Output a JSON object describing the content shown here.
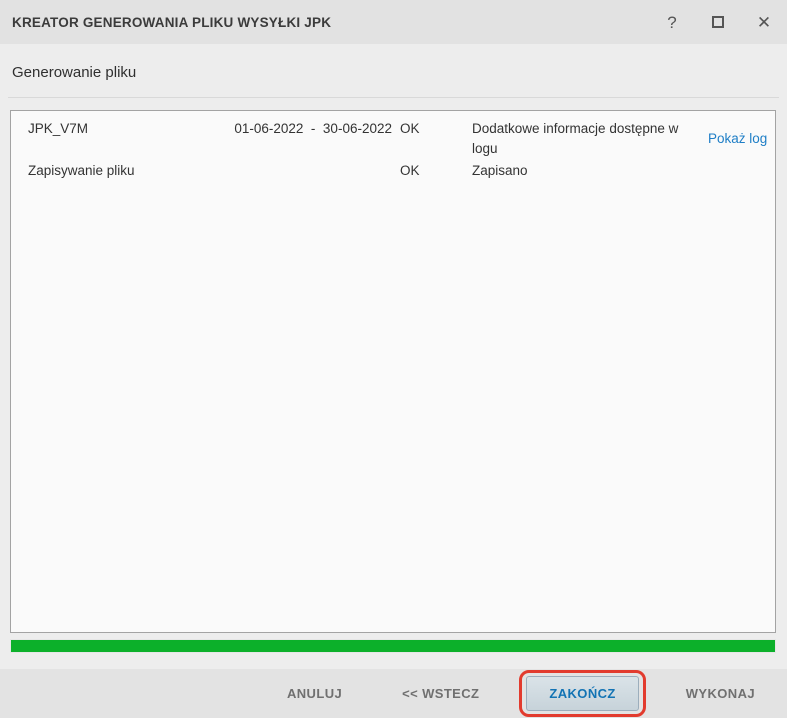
{
  "window": {
    "title": "KREATOR GENEROWANIA PLIKU WYSYŁKI JPK",
    "controls": {
      "help": "?",
      "maximize": "□",
      "close": "✕"
    }
  },
  "heading": "Generowanie pliku",
  "steps": {
    "rows": [
      {
        "name": "JPK_V7M",
        "period": "01-06-2022  -  30-06-2022",
        "status": "OK",
        "message": "Dodatkowe informacje dostępne w logu",
        "link": "Pokaż log"
      },
      {
        "name": "Zapisywanie pliku",
        "period": "",
        "status": "OK",
        "message": "Zapisano",
        "link": ""
      }
    ]
  },
  "progress": {
    "percent": 100
  },
  "footer": {
    "buttons": [
      {
        "label": "ANULUJ"
      },
      {
        "label": "<< WSTECZ"
      },
      {
        "label": "ZAKOŃCZ",
        "highlighted": true
      },
      {
        "label": "WYKONAJ"
      }
    ]
  },
  "colors": {
    "progress_green": "#0cb02a",
    "link_blue": "#1e7ec6",
    "highlight_red": "#e23b2e",
    "primary_button_text": "#1273b4"
  }
}
